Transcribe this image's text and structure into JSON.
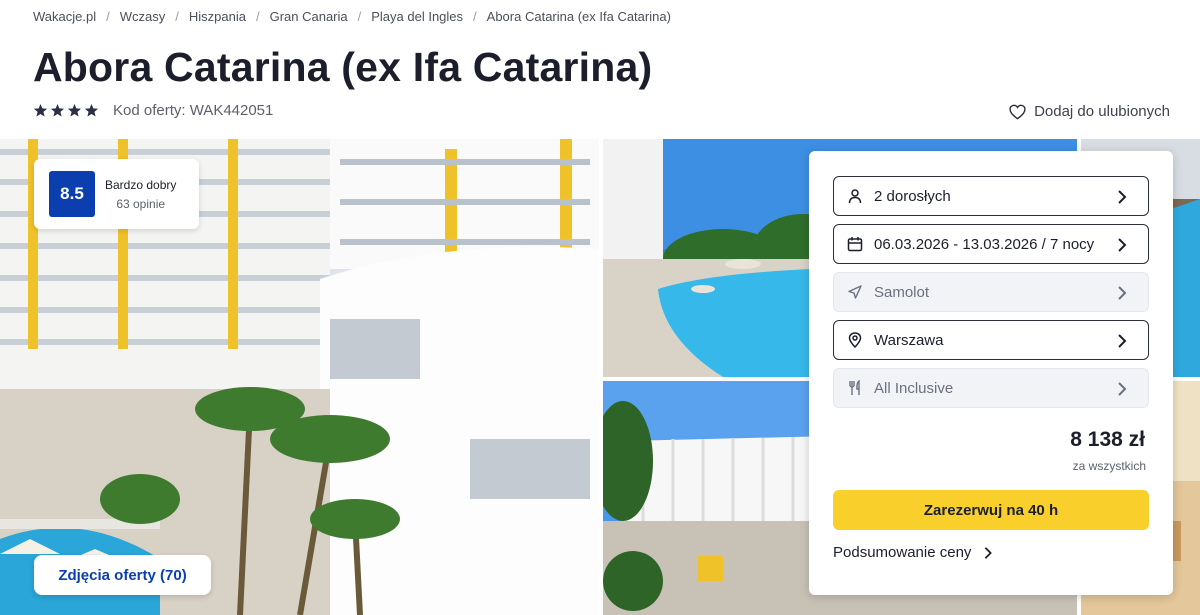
{
  "breadcrumb": [
    "Wakacje.pl",
    "Wczasy",
    "Hiszpania",
    "Gran Canaria",
    "Playa del Ingles",
    "Abora Catarina (ex Ifa Catarina)"
  ],
  "title": "Abora Catarina (ex Ifa Catarina)",
  "stars": 4,
  "offer_code": "Kod oferty: WAK442051",
  "favorite_label": "Dodaj do ulubionych",
  "rating": {
    "score": "8.5",
    "label": "Bardzo dobry",
    "count": "63 opinie"
  },
  "photos_button": "Zdjęcia oferty (70)",
  "booking": {
    "travelers": "2 dorosłych",
    "dates": "06.03.2026 - 13.03.2026 / 7 nocy",
    "transport": "Samolot",
    "departure": "Warszawa",
    "board": "All Inclusive",
    "price": "8 138 zł",
    "price_note": "za wszystkich",
    "book_label": "Zarezerwuj na 40 h",
    "summary_label": "Podsumowanie ceny"
  },
  "colors": {
    "accent": "#0b3fb0",
    "cta": "#f9cf2b",
    "text": "#1c1f2b"
  },
  "icons": {
    "stars": "star-icon",
    "favorite": "heart-icon",
    "travelers": "person-icon",
    "dates": "calendar-icon",
    "transport": "plane-icon",
    "departure": "location-pin-icon",
    "board": "cutlery-icon",
    "chevron": "chevron-right-icon"
  }
}
